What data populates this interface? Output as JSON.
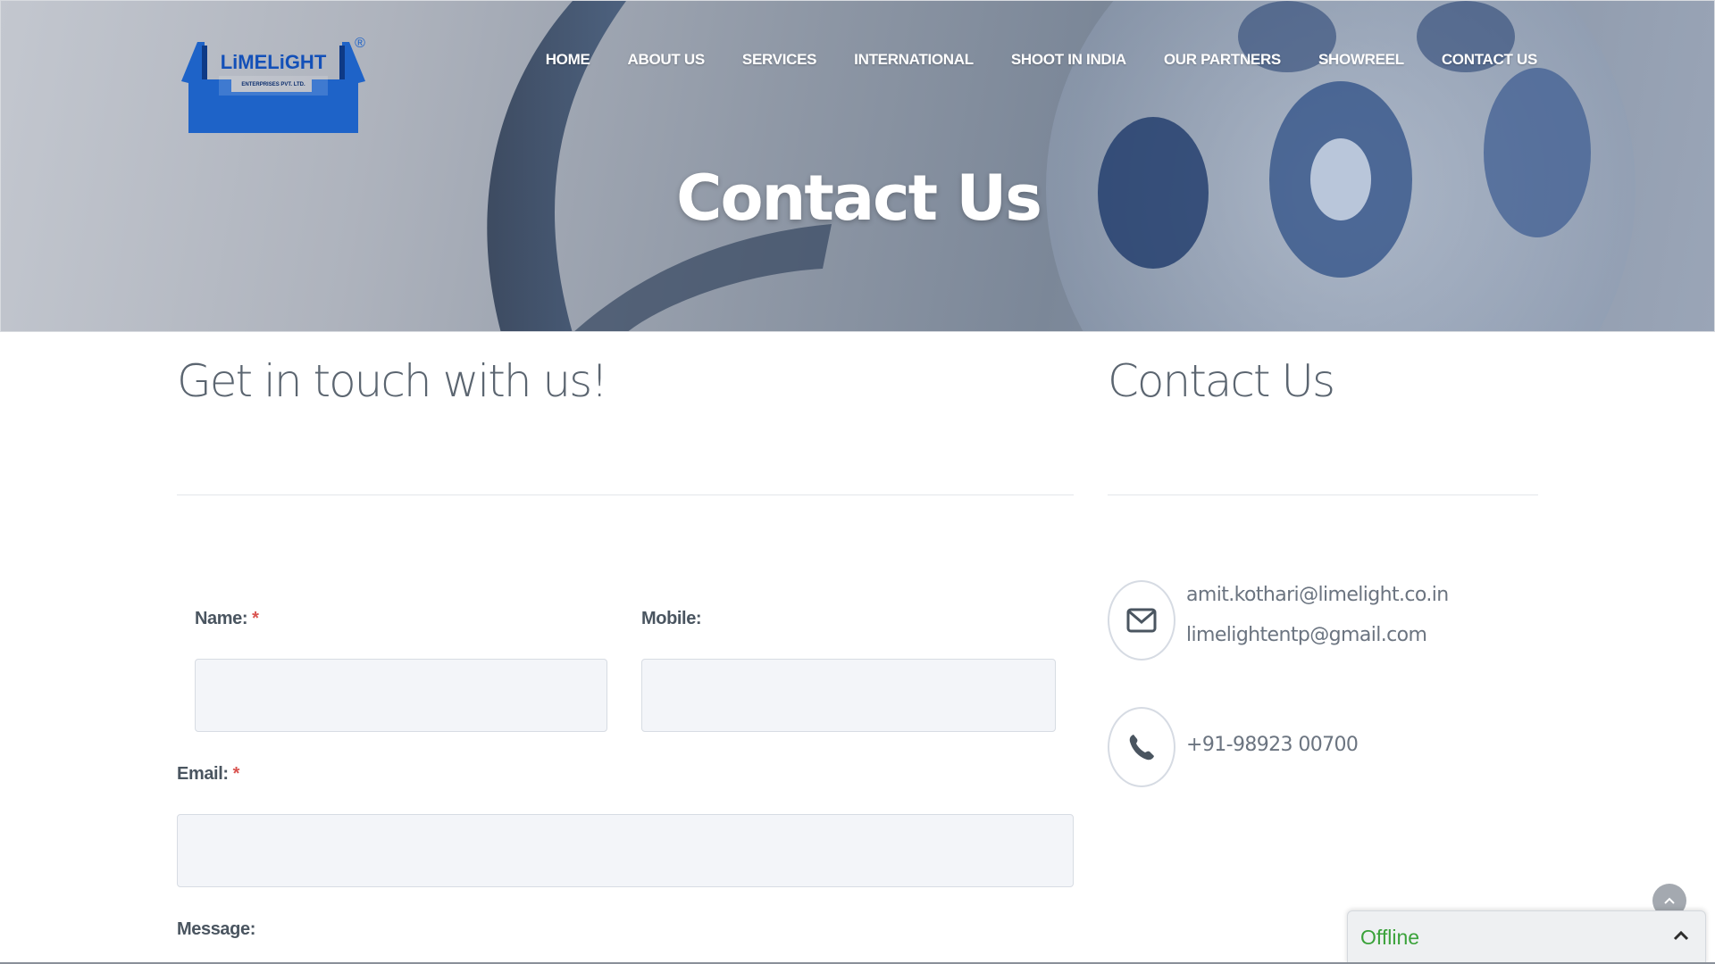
{
  "brand": {
    "logo_text": "LiMELiGHT",
    "logo_subtext": "ENTERPRISES PVT. LTD.",
    "registered_mark": "®"
  },
  "nav": {
    "items": [
      {
        "label": "HOME"
      },
      {
        "label": "ABOUT US"
      },
      {
        "label": "SERVICES"
      },
      {
        "label": "INTERNATIONAL"
      },
      {
        "label": "SHOOT IN INDIA"
      },
      {
        "label": "OUR PARTNERS"
      },
      {
        "label": "SHOWREEL"
      },
      {
        "label": "CONTACT US"
      }
    ]
  },
  "hero": {
    "title": "Contact Us"
  },
  "form": {
    "heading": "Get in touch with us!",
    "name_label": "Name:",
    "mobile_label": "Mobile:",
    "email_label": "Email:",
    "message_label": "Message:",
    "required_mark": "*",
    "name_value": "",
    "mobile_value": "",
    "email_value": ""
  },
  "contact": {
    "heading": "Contact Us",
    "email_primary": "amit.kothari@limelight.co.in",
    "email_secondary": "limelightentp@gmail.com",
    "phone": "+91-98923 00700"
  },
  "chat": {
    "status": "Offline"
  },
  "colors": {
    "accent_blue": "#1f5fbf",
    "required_red": "#d9534f",
    "offline_green": "#3aa23a"
  },
  "icons": {
    "email": "envelope-icon",
    "phone": "phone-icon",
    "scroll_top": "chevron-up-icon",
    "chat_toggle": "chevron-up-icon"
  }
}
